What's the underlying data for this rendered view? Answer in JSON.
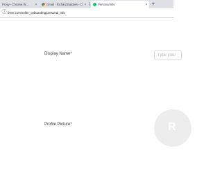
{
  "browser": {
    "tabs": [
      {
        "label": "Proxy - Chrome W...",
        "close": "×"
      },
      {
        "label": "Gmail - Richard Baldwin - Outlo...",
        "close": "×"
      },
      {
        "label": "Personal Info",
        "close": "×"
      }
    ],
    "new_tab": "+",
    "address": "fiverr.com/seller_onboarding/personal_info",
    "info_icon": "ⓘ"
  },
  "form": {
    "display_name_label": "Display Name*",
    "display_name_placeholder": "Type your",
    "profile_picture_label": "Profile Picture*",
    "avatar_initial": "R"
  }
}
